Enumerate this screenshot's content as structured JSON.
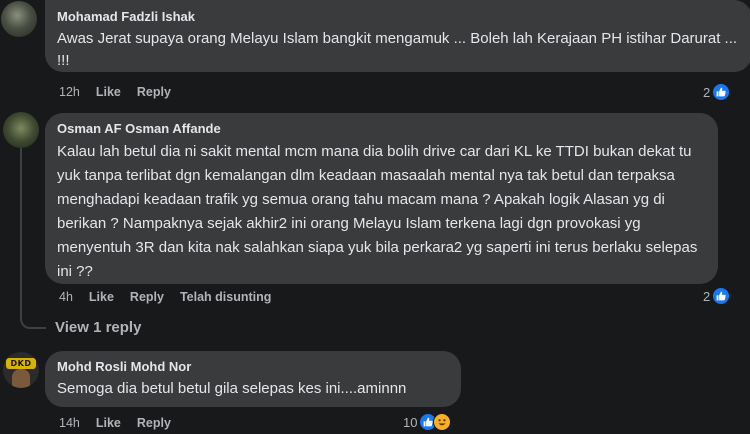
{
  "comments": [
    {
      "author": "Mohamad Fadzli Ishak",
      "text": "Awas Jerat supaya orang Melayu Islam bangkit mengamuk ... Boleh lah Kerajaan PH istihar Darurat ... !!!",
      "time": "12h",
      "like": "Like",
      "reply": "Reply",
      "reaction_count": "2"
    },
    {
      "author": "Osman AF Osman Affande",
      "text": "Kalau lah betul dia ni sakit mental mcm mana dia bolih drive car dari KL ke TTDI bukan dekat tu yuk tanpa terlibat dgn kemalangan dlm keadaan masaalah mental nya tak betul dan terpaksa menghadapi keadaan trafik yg semua orang tahu macam mana ? Apakah logik Alasan yg di berikan ? Nampaknya sejak akhir2 ini orang Melayu Islam terkena lagi dgn provokasi yg menyentuh 3R dan kita nak salahkan siapa yuk bila perkara2 yg saperti ini terus berlaku selepas ini ??",
      "time": "4h",
      "like": "Like",
      "reply": "Reply",
      "edited": "Telah disunting",
      "reaction_count": "2",
      "view_replies": "View 1 reply"
    },
    {
      "author": "Mohd Rosli Mohd Nor",
      "text": "Semoga dia betul betul gila selepas kes ini....aminnn",
      "time": "14h",
      "like": "Like",
      "reply": "Reply",
      "reaction_count": "10",
      "avatar_badge": "DKD"
    }
  ],
  "colors": {
    "background": "#18191a",
    "bubble": "#3a3b3c",
    "text": "#e4e6eb",
    "secondary": "#b0b3b8",
    "like_blue": "#1877f2",
    "haha_yellow": "#f7b125"
  },
  "icons": {
    "like": "like-icon",
    "haha": "haha-icon"
  }
}
